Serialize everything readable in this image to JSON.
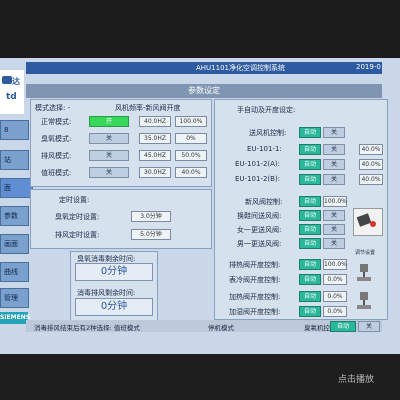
{
  "header": {
    "title": "AHU1101净化空调控制系统",
    "time": "2019-0"
  },
  "page_title": "参数设定",
  "logo": {
    "top": "达",
    "bottom": "td"
  },
  "sidebar": {
    "items": [
      "8",
      "站",
      "面",
      "参数",
      "画面",
      "曲线",
      "管理"
    ],
    "brand": "SIEMENS"
  },
  "mode": {
    "header_left": "模式选择: -",
    "header_right": "风机频率-新风阀开度",
    "rows": [
      {
        "label": "正常模式:",
        "button": "开",
        "v1": "40.0HZ",
        "v2": "100.0%"
      },
      {
        "label": "臭氧模式:",
        "button": "关",
        "v1": "35.0HZ",
        "v2": "0%"
      },
      {
        "label": "排风模式:",
        "button": "关",
        "v1": "45.0HZ",
        "v2": "50.0%"
      },
      {
        "label": "值班模式:",
        "button": "关",
        "v1": "30.0HZ",
        "v2": "40.0%"
      }
    ]
  },
  "timer": {
    "title": "定时设置:",
    "rows": [
      {
        "label": "臭氧定时设置:",
        "value": "3.0分钟"
      },
      {
        "label": "排风定时设置:",
        "value": "5.0分钟"
      }
    ]
  },
  "remaining": [
    {
      "label": "臭氧消毒剩余时间:",
      "value": "0分钟"
    },
    {
      "label": "消毒排风剩余时间:",
      "value": "0分钟"
    }
  ],
  "right": {
    "title": "手自动及开度设定:",
    "rows": [
      {
        "label": "送风机控制:",
        "b1": "自动",
        "b2": "关"
      },
      {
        "label": "EU-101-1:",
        "b1": "自动",
        "b2": "关",
        "val": "40.0%"
      },
      {
        "label": "EU-101-2(A):",
        "b1": "自动",
        "b2": "关",
        "val": "40.0%"
      },
      {
        "label": "EU-101-2(B):",
        "b1": "自动",
        "b2": "关",
        "val": "40.0%"
      }
    ],
    "rows2": [
      {
        "label": "新风阀控制:",
        "b1": "自动",
        "val": "100.0%"
      },
      {
        "label": "换鞋间送风阀:",
        "b1": "自动",
        "b2": "关"
      },
      {
        "label": "女一更送风阀:",
        "b1": "自动",
        "b2": "关"
      },
      {
        "label": "男一更送风阀:",
        "b1": "自动",
        "b2": "关"
      }
    ],
    "damper_caption": "调节设置",
    "rows3": [
      {
        "label": "排热阀开度控制:",
        "b1": "自动",
        "val": "100.0%"
      },
      {
        "label": "表冷阀开度控制:",
        "b1": "自动",
        "val": "0.0%"
      },
      {
        "label": "加热阀开度控制:",
        "b1": "自动",
        "val": "0.0%"
      },
      {
        "label": "加湿阀开度控制:",
        "b1": "自动",
        "val": "0.0%"
      }
    ]
  },
  "bottom": {
    "message": "消毒排风结束后有2种选择: 值班模式",
    "stop_label": "停机模式",
    "ozone_label": "臭氧机控制:",
    "ozone_btn": "自动",
    "ozone_state": "关"
  },
  "watermark": "点击播放"
}
